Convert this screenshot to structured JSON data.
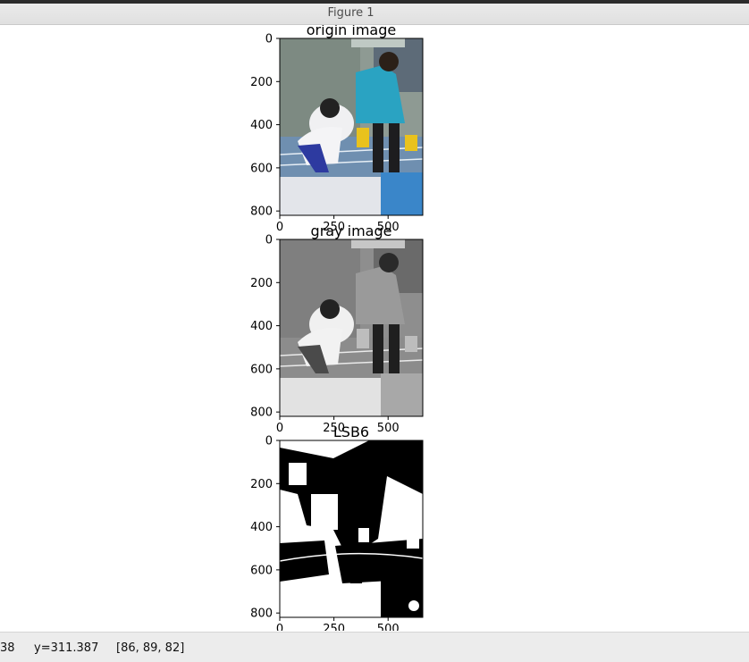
{
  "window": {
    "title": "Figure 1"
  },
  "subplots": [
    {
      "title": "origin image",
      "mode": "color",
      "ytick_labels": [
        "0",
        "200",
        "400",
        "600",
        "800"
      ],
      "xtick_labels": [
        "0",
        "250",
        "500"
      ]
    },
    {
      "title": "gray image",
      "mode": "gray",
      "ytick_labels": [
        "0",
        "200",
        "400",
        "600",
        "800"
      ],
      "xtick_labels": [
        "0",
        "250",
        "500"
      ]
    },
    {
      "title": "LSB6",
      "mode": "binary",
      "ytick_labels": [
        "0",
        "200",
        "400",
        "600",
        "800"
      ],
      "xtick_labels": [
        "0",
        "250",
        "500"
      ]
    }
  ],
  "statusbar": {
    "x_readout": "38",
    "y_readout": "y=311.387",
    "pixel_value": "[86, 89, 82]"
  },
  "colors": {
    "jacket_teal": "#2aa3c2",
    "track_blue": "#6f8fb0",
    "lane_yellow": "#e9c21d",
    "sky_white": "#f2f2f2"
  }
}
